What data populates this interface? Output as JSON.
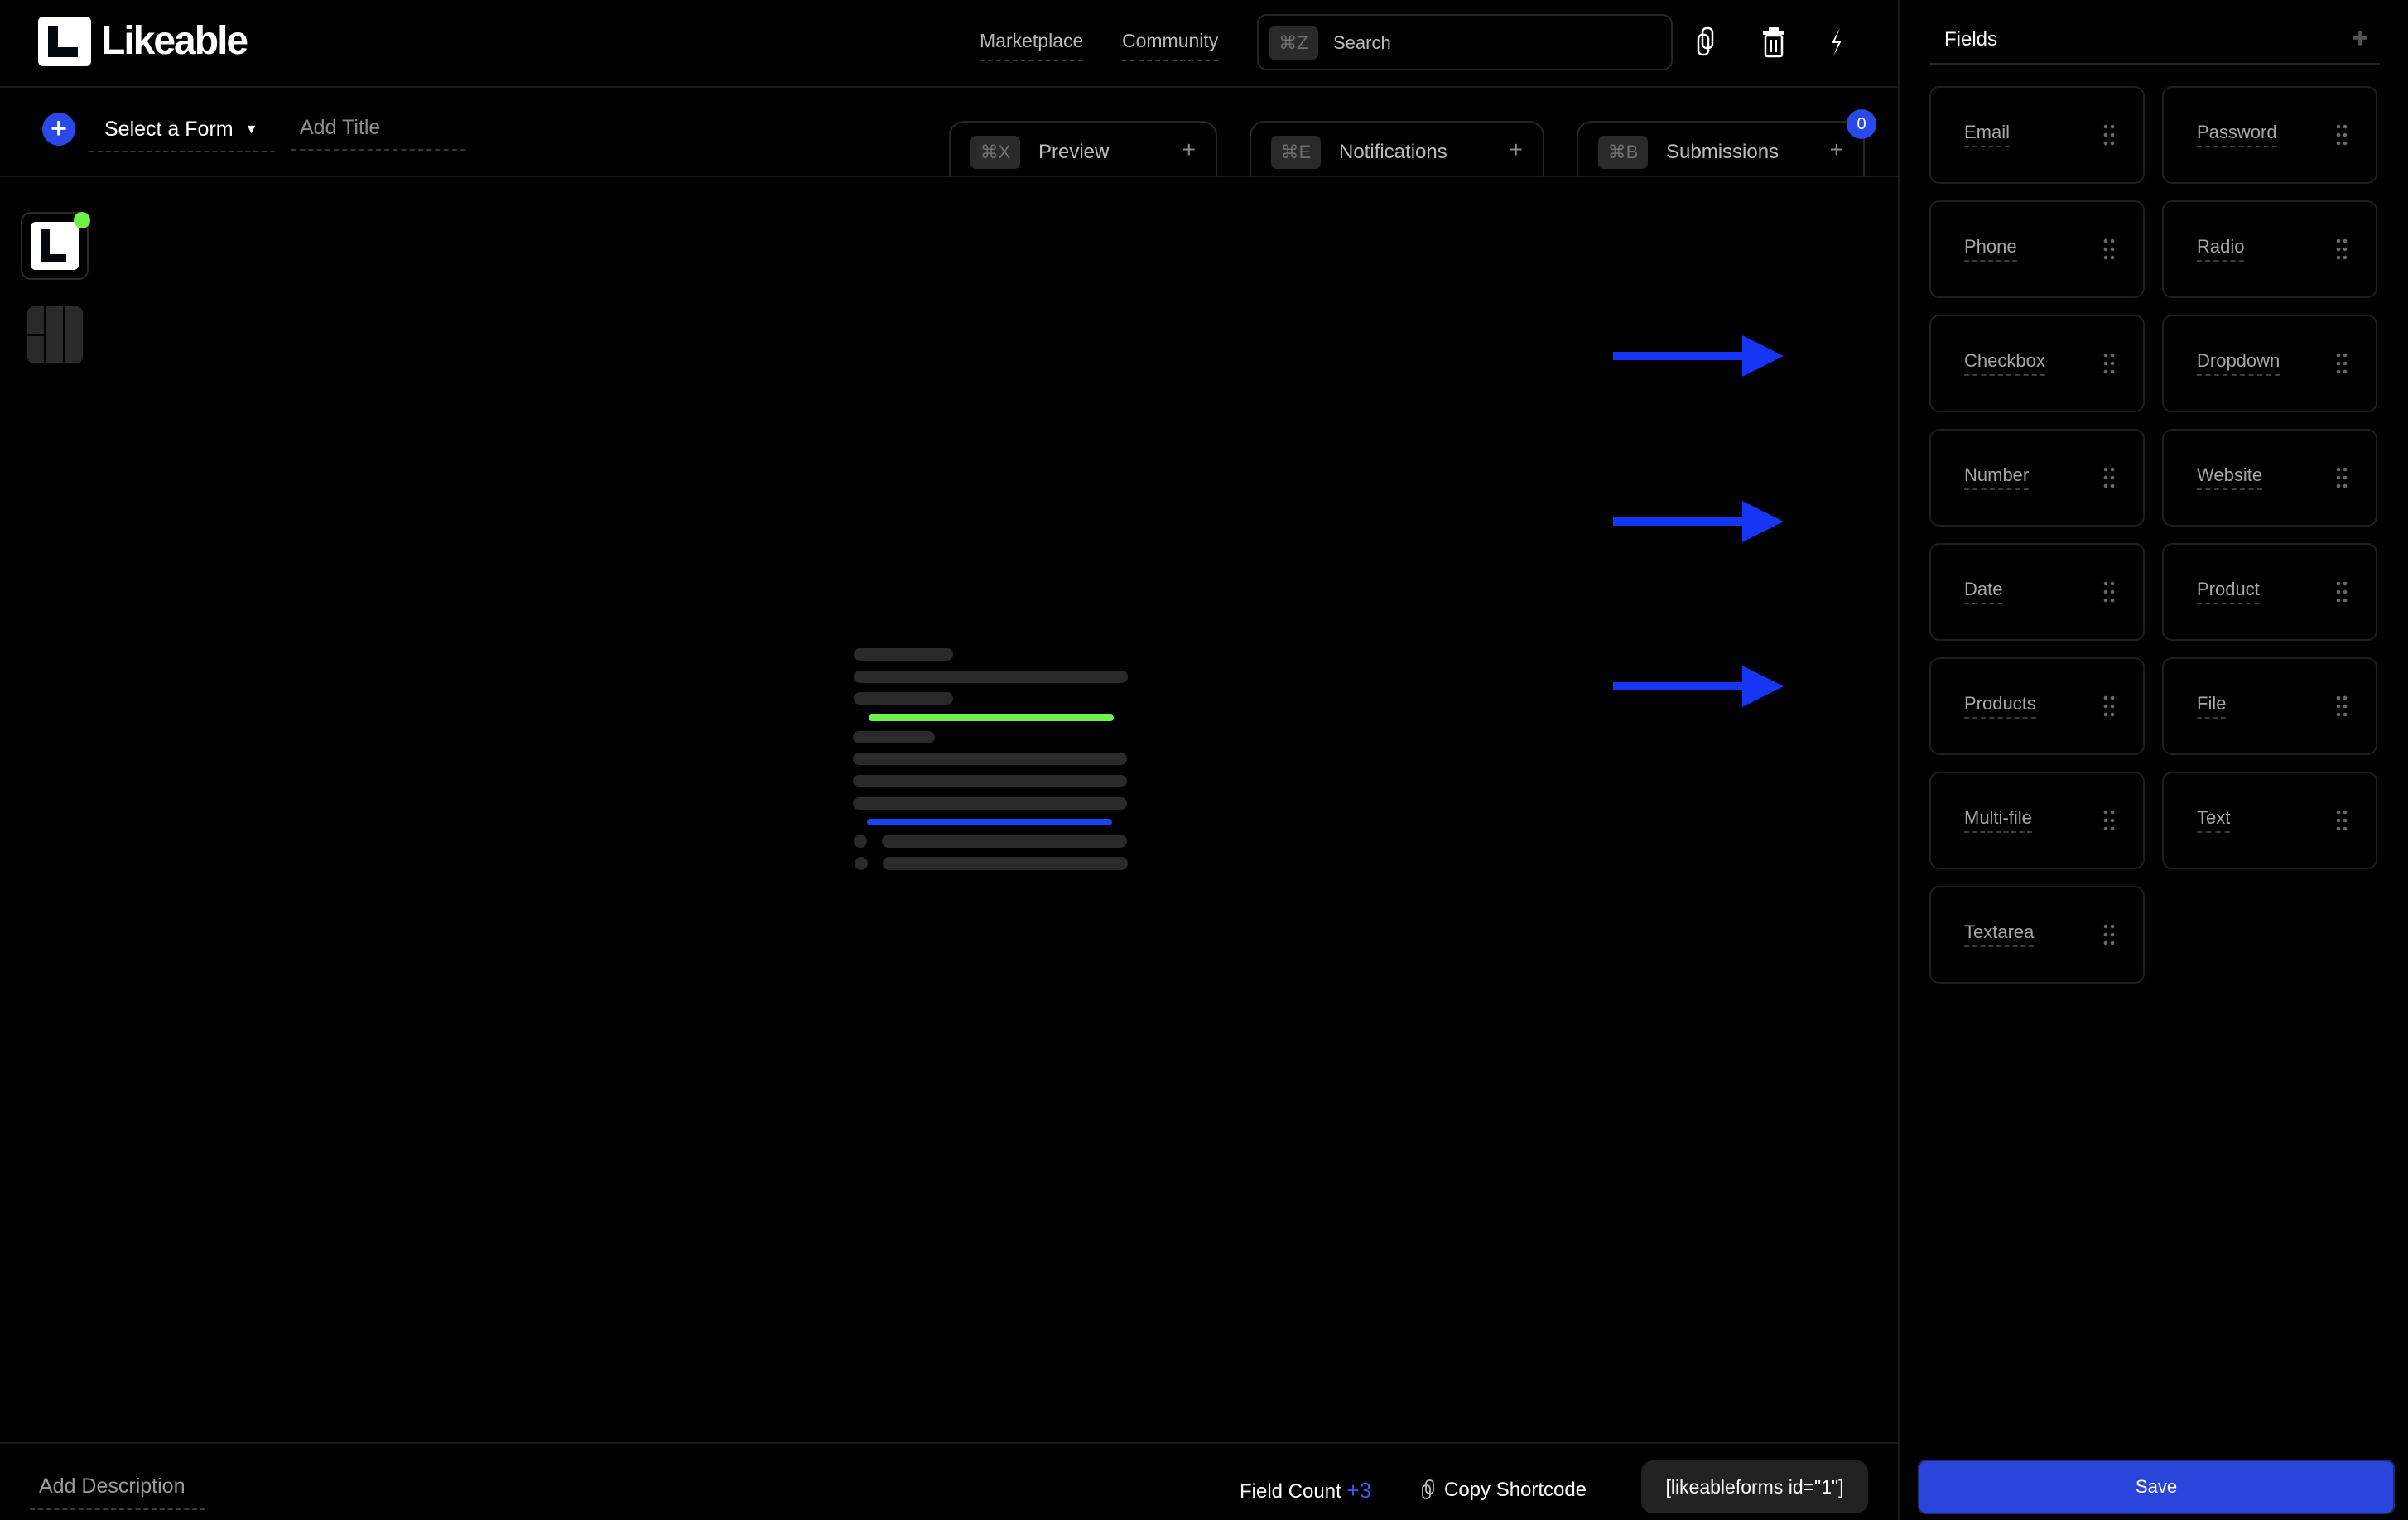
{
  "header": {
    "brand": "Likeable",
    "nav": [
      {
        "label": "Marketplace"
      },
      {
        "label": "Community"
      }
    ],
    "search": {
      "shortcut": "⌘Z",
      "placeholder": "Search"
    },
    "icons": [
      "copy-icon",
      "trash-icon",
      "lightning-icon"
    ]
  },
  "toolbar": {
    "form_select": "Select a Form",
    "title_placeholder": "Add Title",
    "tabs": [
      {
        "shortcut": "⌘X",
        "label": "Preview"
      },
      {
        "shortcut": "⌘E",
        "label": "Notifications"
      },
      {
        "shortcut": "⌘B",
        "label": "Submissions"
      }
    ],
    "submissions_badge": "0"
  },
  "footer": {
    "description_placeholder": "Add Description",
    "field_count_label": "Field Count",
    "field_count_value": "+3",
    "copy_shortcode": "Copy Shortcode",
    "shortcode": "[likeableforms id=\"1\"]"
  },
  "panel": {
    "title": "Fields",
    "fields": [
      "Email",
      "Password",
      "Phone",
      "Radio",
      "Checkbox",
      "Dropdown",
      "Number",
      "Website",
      "Date",
      "Product",
      "Products",
      "File",
      "Multi-file",
      "Text",
      "Textarea"
    ],
    "save_label": "Save"
  },
  "colors": {
    "accent": "#2b48e8",
    "arrow": "#1537f5",
    "status_online": "#6cf24a",
    "highlight_green": "#6cf24a"
  }
}
